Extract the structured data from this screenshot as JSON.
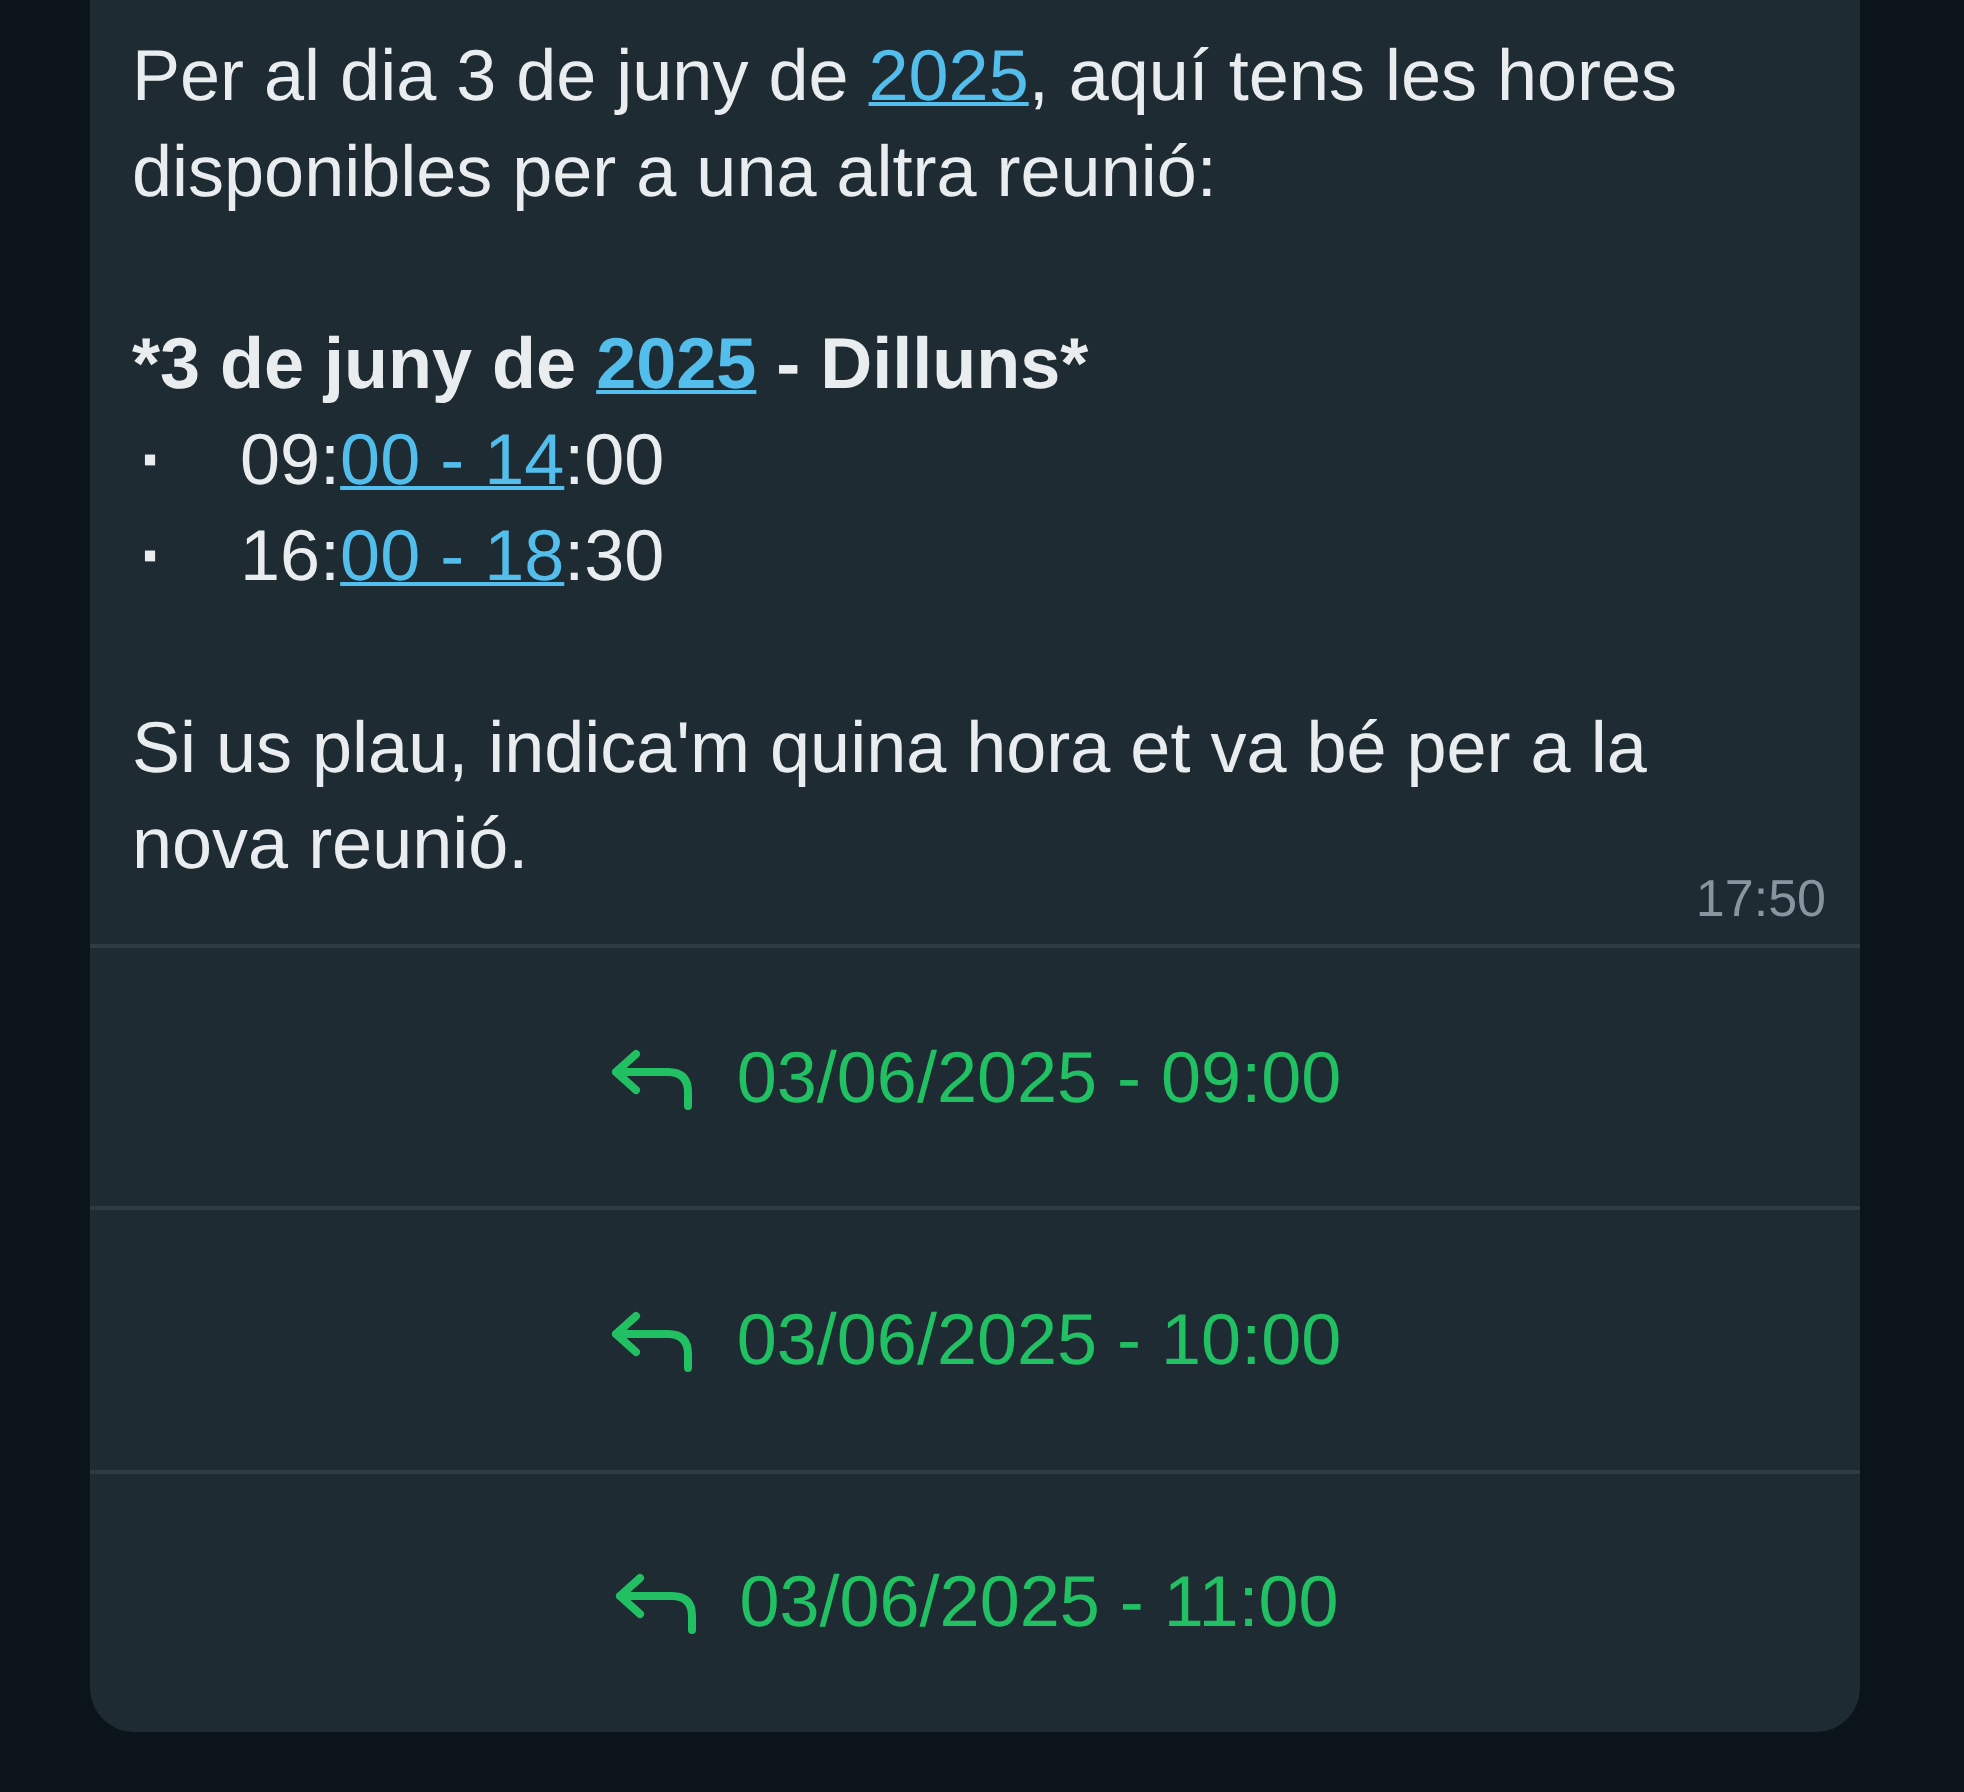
{
  "message": {
    "intro": [
      {
        "text": "Per al dia 3 de juny de ",
        "link": false
      },
      {
        "text": "2025",
        "link": true
      },
      {
        "text": ", aquí tens les hores disponibles per a una altra reunió:",
        "link": false
      }
    ],
    "heading": [
      {
        "text": "*3 de juny de ",
        "link": false
      },
      {
        "text": "2025",
        "link": true
      },
      {
        "text": " - Dilluns*",
        "link": false
      }
    ],
    "slots": [
      {
        "bullet": "·",
        "parts": [
          {
            "text": "09:",
            "link": false
          },
          {
            "text": "00 - 14",
            "link": true
          },
          {
            "text": ":00",
            "link": false
          }
        ]
      },
      {
        "bullet": "·",
        "parts": [
          {
            "text": "16:",
            "link": false
          },
          {
            "text": "00 - 18",
            "link": true
          },
          {
            "text": ":30",
            "link": false
          }
        ]
      }
    ],
    "closing": [
      {
        "text": "Si us plau, indica'm quina hora et va bé per a la nova reunió.",
        "link": false
      }
    ],
    "time": "17:50"
  },
  "reply_buttons": [
    {
      "label": "03/06/2025 - 09:00"
    },
    {
      "label": "03/06/2025 - 10:00"
    },
    {
      "label": "03/06/2025 - 11:00"
    }
  ]
}
